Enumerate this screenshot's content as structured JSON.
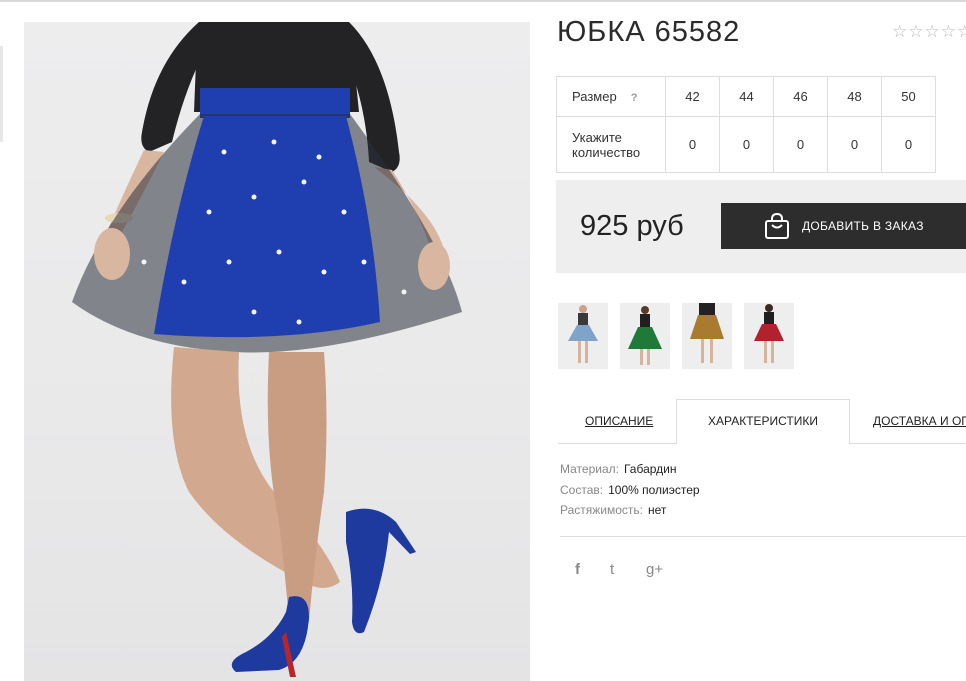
{
  "product": {
    "title": "ЮБКА 65582",
    "rating_stars": "☆☆☆☆☆"
  },
  "size_table": {
    "size_label": "Размер",
    "help_symbol": "?",
    "sizes": [
      "42",
      "44",
      "46",
      "48",
      "50"
    ],
    "quantity_label_line1": "Укажите",
    "quantity_label_line2": "количество",
    "quantities": [
      "0",
      "0",
      "0",
      "0",
      "0"
    ]
  },
  "price": {
    "value": "925 руб",
    "add_button_label": "ДОБАВИТЬ В ЗАКАЗ"
  },
  "tabs": {
    "description": "ОПИСАНИЕ",
    "characteristics": "ХАРАКТЕРИСТИКИ",
    "delivery": "ДОСТАВКА И ОПЛАТА"
  },
  "specs": [
    {
      "key": "Материал:",
      "value": "Габардин"
    },
    {
      "key": "Состав:",
      "value": "100% полиэстер"
    },
    {
      "key": "Растяжимость:",
      "value": "нет"
    }
  ],
  "social": {
    "facebook": "f",
    "twitter": "t",
    "google_plus": "g+"
  },
  "colors": {
    "button_bg": "#2d2d2d",
    "price_bar_bg": "#eeeeee",
    "skirt_blue": "#1f3fb0",
    "thumb_skirts": [
      "#7fa3c9",
      "#1f7a3a",
      "#a87b2e",
      "#b3202e"
    ]
  }
}
